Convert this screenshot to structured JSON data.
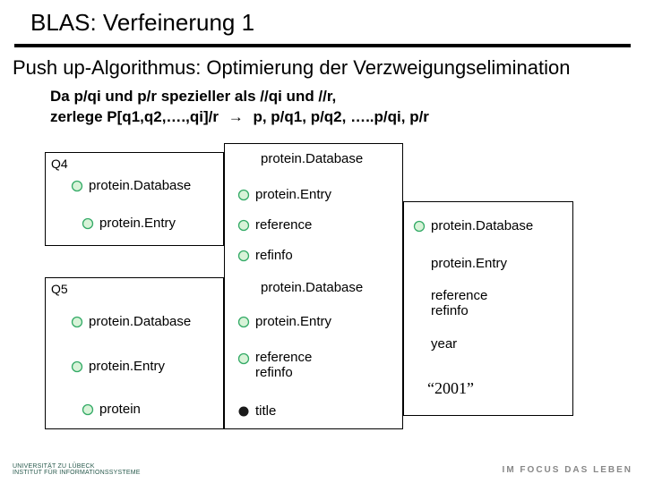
{
  "title": "BLAS: Verfeinerung 1",
  "subtitle": "Push up-Algorithmus: Optimierung der Verzweigungselimination",
  "desc_line1": "Da p/qi und p/r spezieller als //qi und //r,",
  "desc_line2a": "zerlege P[q1,q2,….,qi]/r",
  "desc_arrow": "→",
  "desc_line2b": "p, p/q1, p/q2, …..p/qi, p/r",
  "q4": {
    "label": "Q4",
    "items": [
      "protein.Database",
      "protein.Entry"
    ]
  },
  "q5": {
    "label": "Q5",
    "items": [
      "protein.Database",
      "protein.Entry",
      "protein"
    ]
  },
  "col2_top": [
    "protein.Database",
    "protein.Entry",
    "reference",
    "refinfo"
  ],
  "col2_bot": [
    "protein.Database",
    "protein.Entry",
    "reference\nrefinfo",
    "title"
  ],
  "col3": {
    "items": [
      "protein.Database",
      "protein.Entry",
      "reference\nrefinfo",
      "year"
    ],
    "year_value": "“2001”"
  },
  "footer": {
    "uni_line1": "UNIVERSITÄT ZU LÜBECK",
    "uni_line2": "INSTITUT FÜR INFORMATIONSSYSTEME",
    "tagline": "IM FOCUS DAS LEBEN"
  },
  "icons": {
    "open_circle": "open-circle-icon",
    "filled_circle": "filled-circle-icon"
  }
}
